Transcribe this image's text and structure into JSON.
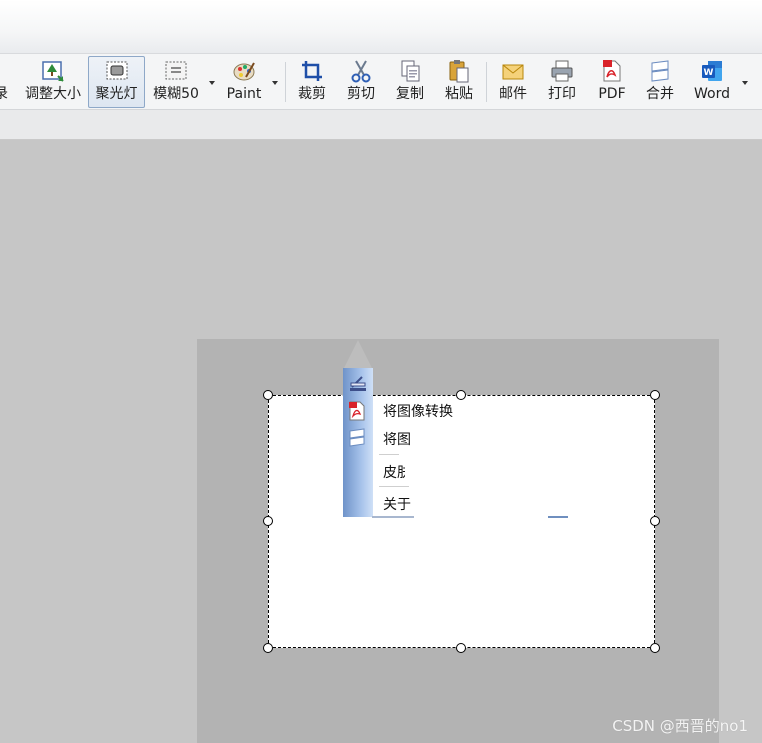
{
  "toolbar": {
    "partial_left": "录",
    "buttons": [
      {
        "id": "resize",
        "label": "调整大小",
        "icon": "resize-icon"
      },
      {
        "id": "spotlight",
        "label": "聚光灯",
        "icon": "spotlight-icon",
        "active": true
      },
      {
        "id": "blur",
        "label": "模糊50",
        "icon": "blur-icon"
      },
      {
        "id": "paint",
        "label": "Paint",
        "icon": "palette-icon"
      },
      {
        "id": "crop",
        "label": "裁剪",
        "icon": "crop-icon"
      },
      {
        "id": "cut",
        "label": "剪切",
        "icon": "scissors-icon"
      },
      {
        "id": "copy",
        "label": "复制",
        "icon": "copy-icon"
      },
      {
        "id": "paste",
        "label": "粘贴",
        "icon": "paste-icon"
      },
      {
        "id": "mail",
        "label": "邮件",
        "icon": "envelope-icon"
      },
      {
        "id": "print",
        "label": "打印",
        "icon": "printer-icon"
      },
      {
        "id": "pdf",
        "label": "PDF",
        "icon": "pdf-icon"
      },
      {
        "id": "merge",
        "label": "合并",
        "icon": "merge-icon"
      },
      {
        "id": "word",
        "label": "Word",
        "icon": "word-icon"
      }
    ]
  },
  "context_menu": {
    "items": [
      "将图像转换",
      "将图",
      "皮肤",
      "关于"
    ]
  },
  "watermark": "CSDN @西晋的no1",
  "colors": {
    "accent": "#6f93c9",
    "canvas": "#b3b3b3",
    "workspace": "#c6c6c6"
  }
}
